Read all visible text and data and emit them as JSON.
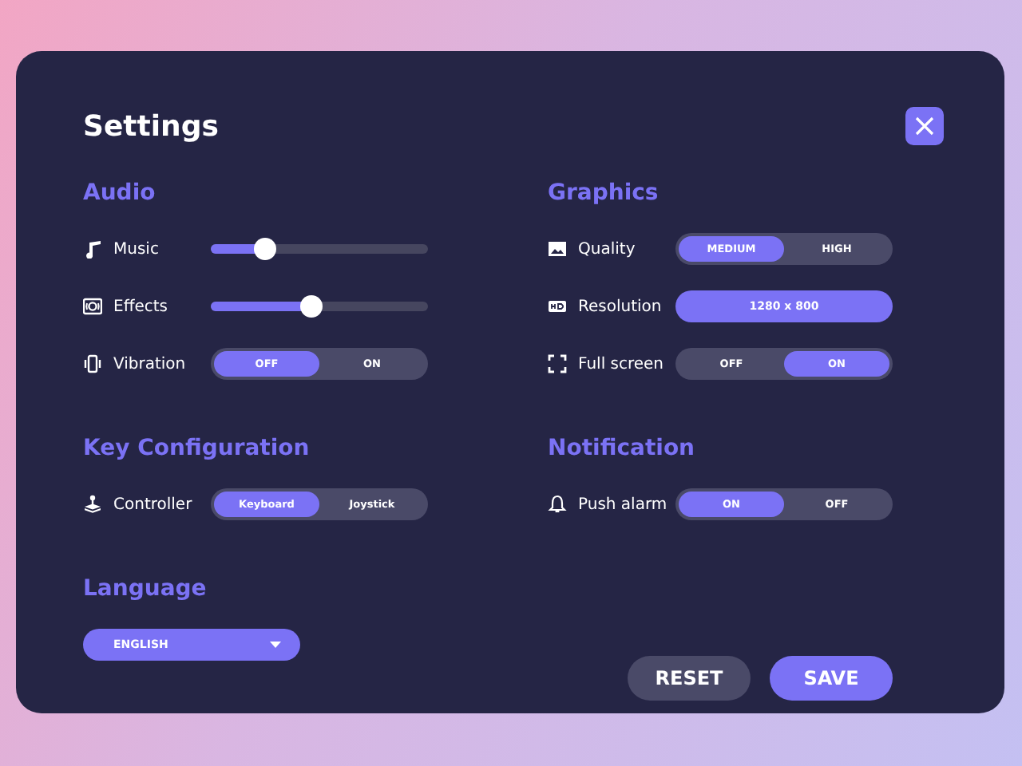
{
  "title": "Settings",
  "columns": [
    {
      "sections": [
        {
          "title": "Audio",
          "rows": [
            {
              "kind": "slider",
              "label": "Music",
              "level": 0.25
            },
            {
              "kind": "slider",
              "label": "Effects",
              "level": 0.46
            },
            {
              "kind": "toggle",
              "label": "Vibration",
              "options": [
                {
                  "label": "OFF",
                  "selected": true
                },
                {
                  "label": "ON",
                  "selected": false
                }
              ]
            }
          ]
        },
        {
          "title": "Key Configuration",
          "rows": [
            {
              "kind": "toggle",
              "label": "Controller",
              "options": [
                {
                  "label": "Keyboard",
                  "selected": true
                },
                {
                  "label": "Joystick",
                  "selected": false
                }
              ]
            }
          ]
        },
        {
          "title": "Language",
          "rows": [
            {
              "kind": "dropdown",
              "value": "ENGLISH"
            }
          ]
        }
      ]
    },
    {
      "sections": [
        {
          "title": "Graphics",
          "rows": [
            {
              "kind": "toggle",
              "label": "Quality",
              "options": [
                {
                  "label": "MEDIUM",
                  "selected": true
                },
                {
                  "label": "HIGH",
                  "selected": false
                }
              ]
            },
            {
              "kind": "value",
              "label": "Resolution",
              "value": "1280 x 800"
            },
            {
              "kind": "toggle",
              "label": "Full screen",
              "options": [
                {
                  "label": "OFF",
                  "selected": false
                },
                {
                  "label": "ON",
                  "selected": true
                }
              ]
            }
          ]
        },
        {
          "title": "Notification",
          "rows": [
            {
              "kind": "toggle",
              "label": "Push alarm",
              "options": [
                {
                  "label": "ON",
                  "selected": true
                },
                {
                  "label": "OFF",
                  "selected": false
                }
              ]
            }
          ]
        }
      ]
    }
  ],
  "buttons": [
    {
      "label": "RESET",
      "kind": "secondary"
    },
    {
      "label": "SAVE",
      "kind": "primary"
    }
  ]
}
